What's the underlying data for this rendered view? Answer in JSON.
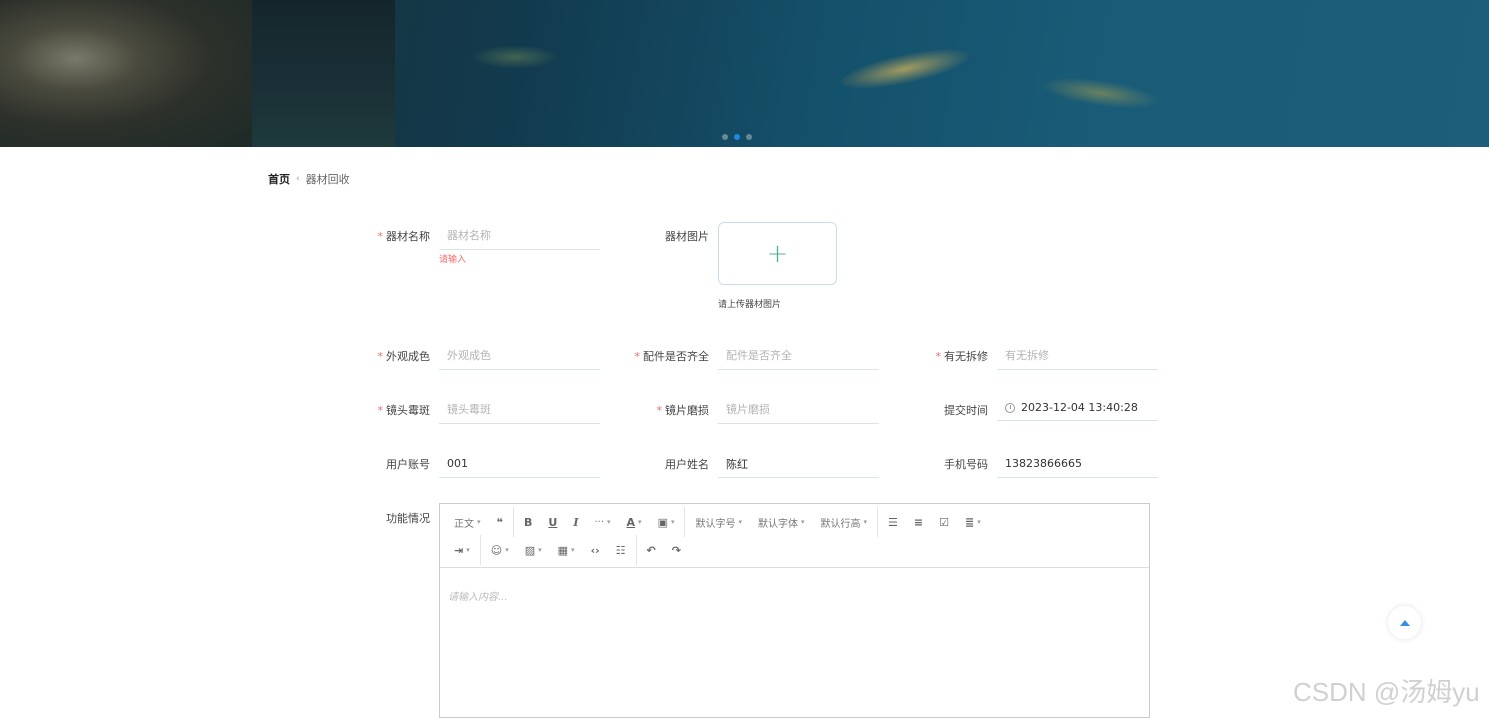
{
  "carousel": {
    "slide_count": 3,
    "active_index": 1,
    "accent": "#1e88e5"
  },
  "breadcrumb": {
    "home": "首页",
    "separator": "‹",
    "current": "器材回收"
  },
  "form": {
    "equipment_name": {
      "label": "器材名称",
      "required": true,
      "placeholder": "器材名称",
      "value": "",
      "error": "请输入"
    },
    "equipment_image": {
      "label": "器材图片",
      "hint": "请上传器材图片",
      "icon": "plus-icon"
    },
    "appearance": {
      "label": "外观成色",
      "required": true,
      "placeholder": "外观成色",
      "value": ""
    },
    "accessories": {
      "label": "配件是否齐全",
      "required": true,
      "placeholder": "配件是否齐全",
      "value": ""
    },
    "disassembly": {
      "label": "有无拆修",
      "required": true,
      "placeholder": "有无拆修",
      "value": ""
    },
    "lens_mold": {
      "label": "镜头霉斑",
      "required": true,
      "placeholder": "镜头霉斑",
      "value": ""
    },
    "lens_wear": {
      "label": "镜片磨损",
      "required": true,
      "placeholder": "镜片磨损",
      "value": ""
    },
    "submit_time": {
      "label": "提交时间",
      "value": "2023-12-04 13:40:28"
    },
    "user_account": {
      "label": "用户账号",
      "value": "001"
    },
    "user_name": {
      "label": "用户姓名",
      "value": "陈红"
    },
    "phone": {
      "label": "手机号码",
      "value": "13823866665"
    },
    "function_status": {
      "label": "功能情况",
      "placeholder": "请输入内容..."
    }
  },
  "editor_toolbar": {
    "paragraph": "正文",
    "font_size": "默认字号",
    "font_family": "默认字体",
    "line_height": "默认行高",
    "more": "···"
  },
  "watermark": "CSDN @汤姆yu",
  "colors": {
    "required": "#f56c6c",
    "upload_plus": "#4caf94",
    "backtop": "#3a8ee6"
  }
}
